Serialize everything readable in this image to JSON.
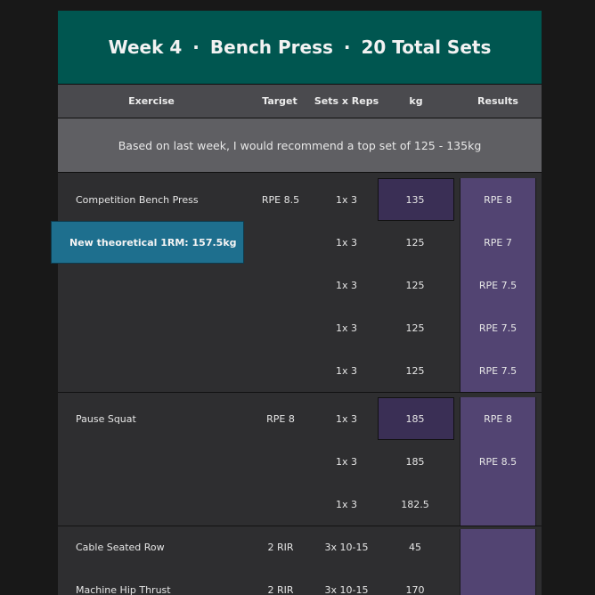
{
  "title": {
    "week": "Week 4",
    "exercise": "Bench Press",
    "total_sets": "20 Total Sets",
    "separator": "·"
  },
  "columns": {
    "exercise": "Exercise",
    "target": "Target",
    "sets_reps": "Sets x Reps",
    "kg": "kg",
    "results": "Results"
  },
  "recommendation": "Based on last week, I would recommend a top set of 125 - 135kg",
  "callout": "New theoretical 1RM:  157.5kg",
  "exercises": [
    {
      "name": "Competition Bench Press",
      "target": "RPE 8.5",
      "sets": [
        {
          "sets_reps": "1x 3",
          "kg": "135",
          "result": "RPE 8"
        },
        {
          "sets_reps": "1x 3",
          "kg": "125",
          "result": "RPE 7"
        },
        {
          "sets_reps": "1x 3",
          "kg": "125",
          "result": "RPE 7.5"
        },
        {
          "sets_reps": "1x 3",
          "kg": "125",
          "result": "RPE 7.5"
        },
        {
          "sets_reps": "1x 3",
          "kg": "125",
          "result": "RPE 7.5"
        }
      ]
    },
    {
      "name": "Pause Squat",
      "target": "RPE 8",
      "sets": [
        {
          "sets_reps": "1x 3",
          "kg": "185",
          "result": "RPE 8"
        },
        {
          "sets_reps": "1x 3",
          "kg": "185",
          "result": "RPE 8.5"
        },
        {
          "sets_reps": "1x 3",
          "kg": "182.5",
          "result": ""
        }
      ]
    },
    {
      "name": "Cable Seated Row",
      "target": "2 RIR",
      "sets": [
        {
          "sets_reps": "3x 10-15",
          "kg": "45",
          "result": ""
        }
      ]
    },
    {
      "name": "Machine Hip Thrust",
      "target": "2 RIR",
      "sets": [
        {
          "sets_reps": "3x 10-15",
          "kg": "170",
          "result": ""
        }
      ]
    }
  ],
  "colors": {
    "title_bg": "#005650",
    "header_bg": "#4a4a4e",
    "recommendation_bg": "#5f5f63",
    "results_bg": "#524472",
    "kg_highlight_bg": "#3a2f55",
    "callout_bg": "#1e6f8e"
  }
}
